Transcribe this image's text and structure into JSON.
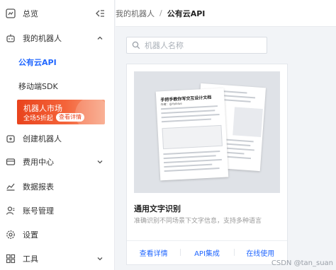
{
  "sidebar": {
    "items": [
      {
        "label": "总览",
        "icon": "dashboard-icon"
      },
      {
        "label": "我的机器人",
        "icon": "robot-icon",
        "chevron": "up"
      },
      {
        "label": "创建机器人",
        "icon": "create-robot-icon"
      },
      {
        "label": "费用中心",
        "icon": "cost-icon",
        "chevron": "down"
      },
      {
        "label": "数据报表",
        "icon": "chart-icon"
      },
      {
        "label": "账号管理",
        "icon": "account-icon"
      },
      {
        "label": "设置",
        "icon": "settings-icon"
      },
      {
        "label": "工具",
        "icon": "tools-icon",
        "chevron": "down"
      }
    ],
    "sub_items": [
      {
        "label": "公有云API",
        "active": true
      },
      {
        "label": "移动端SDK",
        "active": false
      }
    ],
    "promo": {
      "title": "机器人市场",
      "subtitle": "全场5折起",
      "button": "查看详情"
    }
  },
  "header": {
    "breadcrumb": [
      "我的机器人",
      "公有云API"
    ],
    "separator": "/"
  },
  "search": {
    "placeholder": "机器人名称",
    "value": ""
  },
  "card": {
    "preview": {
      "doc_title": "手把手教你写交互设计文档",
      "doc_author": "作者：@Yoiblue"
    },
    "title": "通用文字识别",
    "description": "准确识别不同场景下文字信息，支持多种语言",
    "actions": [
      "查看详情",
      "API集成",
      "在线使用"
    ]
  },
  "watermark": "CSDN @tan_suan",
  "colors": {
    "accent": "#2167ff",
    "promo": "#e9431d",
    "background": "#f2f4f7"
  }
}
